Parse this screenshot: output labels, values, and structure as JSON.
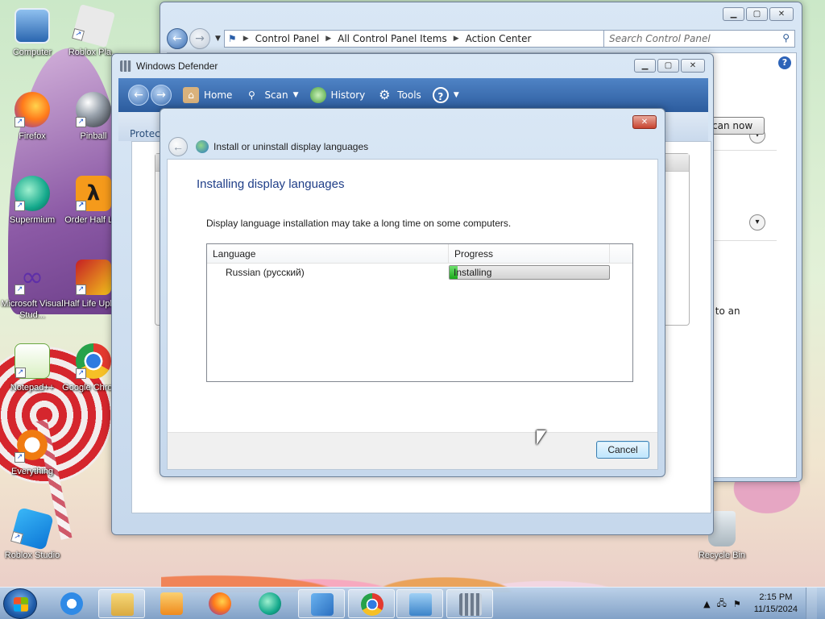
{
  "desktop": {
    "icons": [
      {
        "label": "Computer"
      },
      {
        "label": "Roblox Pla..."
      },
      {
        "label": "Firefox"
      },
      {
        "label": "Pinball"
      },
      {
        "label": "Supermium"
      },
      {
        "label": "Order Half Life"
      },
      {
        "label": "Microsoft Visual Stud..."
      },
      {
        "label": "Half Life Uplink"
      },
      {
        "label": "Notepad++"
      },
      {
        "label": "Google Chrome"
      },
      {
        "label": "Everything"
      },
      {
        "label": "Roblox Studio"
      },
      {
        "label": "Recycle Bin"
      }
    ]
  },
  "control_panel": {
    "breadcrumb": [
      "Control Panel",
      "All Control Panel Items",
      "Action Center"
    ],
    "search_placeholder": "Search Control Panel",
    "scan_button": "can now",
    "fragment_text": "r to an",
    "help_icon": "?"
  },
  "defender": {
    "title": "Windows Defender",
    "toolbar": {
      "home": "Home",
      "scan": "Scan",
      "history": "History",
      "tools": "Tools",
      "help": "?"
    },
    "protect_label": "Protect"
  },
  "dialog": {
    "title": "Install or uninstall display languages",
    "heading": "Installing display languages",
    "description": "Display language installation may take a long time on some computers.",
    "columns": [
      "Language",
      "Progress"
    ],
    "rows": [
      {
        "language": "Russian (русский)",
        "status": "Installing",
        "progress": 0.05
      }
    ],
    "cancel_label": "Cancel",
    "close_glyph": "✕"
  },
  "taskbar": {
    "time": "2:15 PM",
    "date": "11/15/2024",
    "apps": [
      "internet-explorer",
      "windows-explorer",
      "media-player",
      "firefox",
      "supermium",
      "control-panel",
      "chrome",
      "remote-desktop",
      "windows-defender"
    ]
  },
  "colors": {
    "accent": "#1f3e88",
    "progress_green": "#1aa81a",
    "toolbar_blue": "#2c5c9e"
  }
}
